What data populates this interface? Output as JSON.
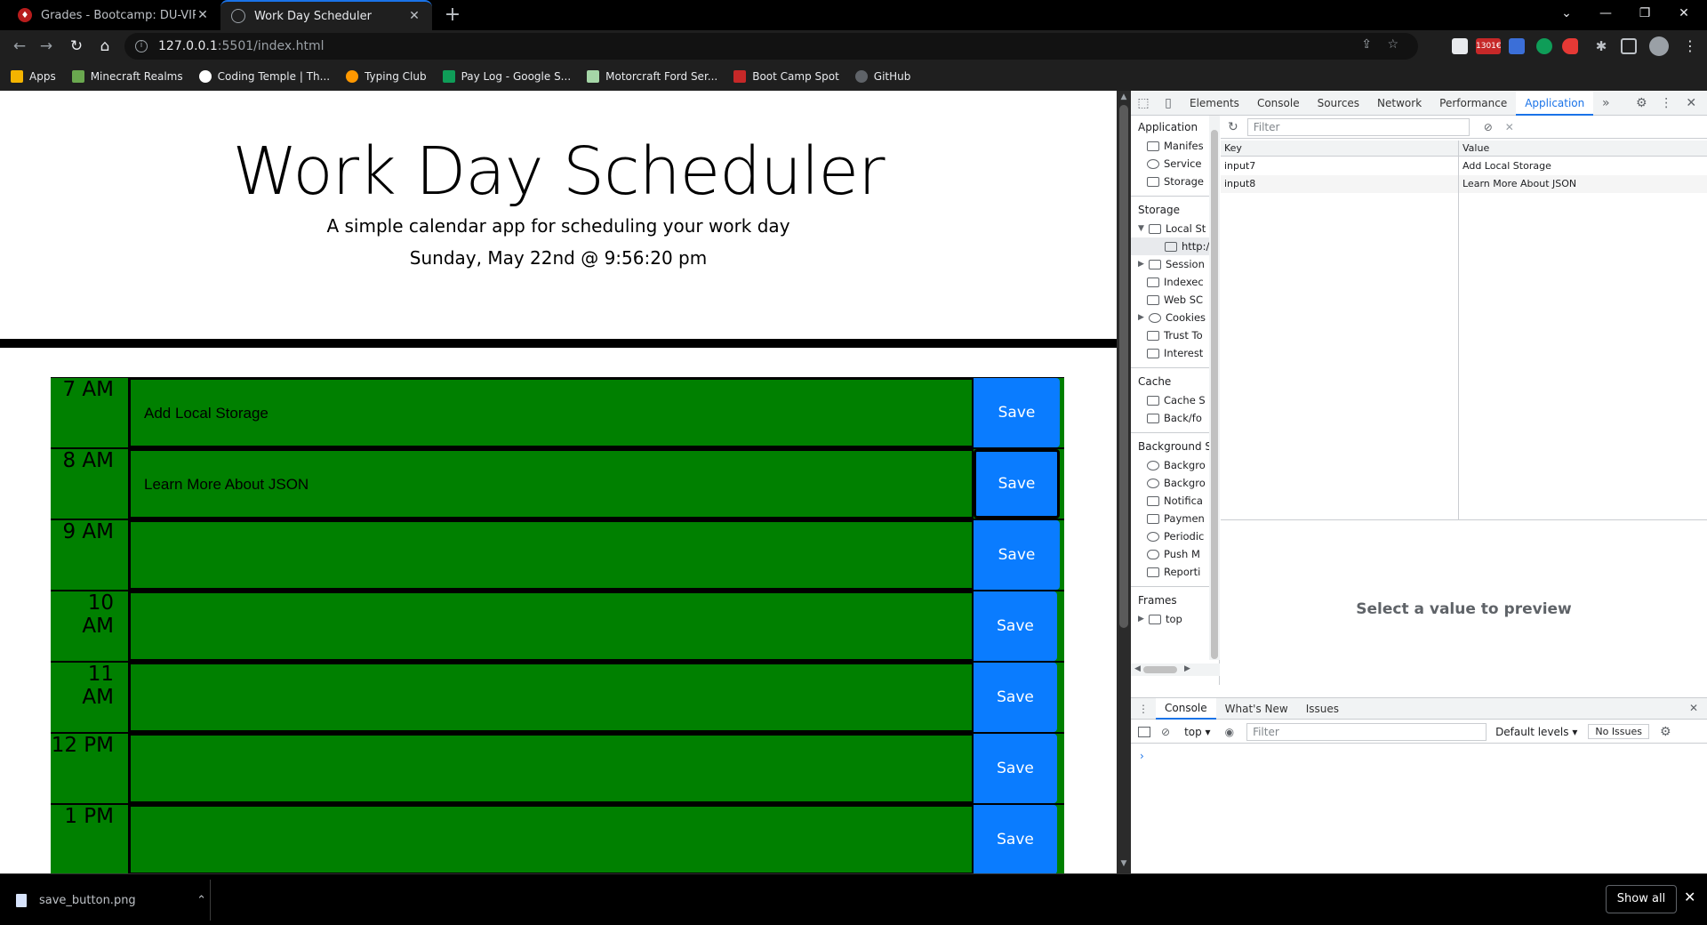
{
  "browser": {
    "tabs": [
      {
        "title": "Grades - Bootcamp: DU-VIRT-FSF",
        "favicon": "red-shield-icon"
      },
      {
        "title": "Work Day Scheduler",
        "favicon": "globe-icon",
        "active": true
      }
    ],
    "address": {
      "host": "127.0.0.1",
      "path": ":5501/index.html"
    },
    "extension_badge": "1301€",
    "bookmarks": [
      {
        "label": "Apps",
        "icon": "apps-grid-icon",
        "color": "#f4b400"
      },
      {
        "label": "Minecraft Realms",
        "icon": "grass-block-icon",
        "color": "#6aa84f"
      },
      {
        "label": "Coding Temple | Th...",
        "icon": "coding-temple-icon",
        "color": "#ffffff"
      },
      {
        "label": "Typing Club",
        "icon": "typing-club-icon",
        "color": "#ff9800"
      },
      {
        "label": "Pay Log - Google S...",
        "icon": "sheets-icon",
        "color": "#0f9d58"
      },
      {
        "label": "Motorcraft Ford Ser...",
        "icon": "motorcraft-icon",
        "color": "#a5d6a7"
      },
      {
        "label": "Boot Camp Spot",
        "icon": "red-shield-icon",
        "color": "#c62828"
      },
      {
        "label": "GitHub",
        "icon": "github-icon",
        "color": "#9aa0a6"
      }
    ]
  },
  "app": {
    "title": "Work Day Scheduler",
    "lead": "A simple calendar app for scheduling your work day",
    "current_day": "Sunday, May 22nd @ 9:56:20 pm",
    "row_color": "#008000",
    "save_color": "#0a7cff",
    "rows": [
      {
        "hour": "7 AM",
        "text": "Add Local Storage",
        "save": "Save"
      },
      {
        "hour": "8 AM",
        "text": "Learn More About JSON",
        "save": "Save"
      },
      {
        "hour": "9 AM",
        "text": "",
        "save": "Save"
      },
      {
        "hour": "10 AM",
        "text": "",
        "save": "Save"
      },
      {
        "hour": "11 AM",
        "text": "",
        "save": "Save"
      },
      {
        "hour": "12 PM",
        "text": "",
        "save": "Save"
      },
      {
        "hour": "1 PM",
        "text": "",
        "save": "Save"
      }
    ]
  },
  "devtools": {
    "tabs": [
      "Elements",
      "Console",
      "Sources",
      "Network",
      "Performance",
      "Application"
    ],
    "active_tab": "Application",
    "more": "»",
    "sidebar": {
      "application": {
        "header": "Application",
        "items": [
          "Manifes",
          "Service",
          "Storage"
        ]
      },
      "storage": {
        "header": "Storage",
        "items": [
          "Local St",
          "http:/",
          "Session",
          "Indexec",
          "Web SC",
          "Cookies",
          "Trust To",
          "Interest"
        ]
      },
      "cache": {
        "header": "Cache",
        "items": [
          "Cache S",
          "Back/fo"
        ]
      },
      "background": {
        "header": "Background Se",
        "items": [
          "Backgro",
          "Backgro",
          "Notifica",
          "Paymen",
          "Periodic",
          "Push M",
          "Reporti"
        ]
      },
      "frames": {
        "header": "Frames",
        "items": [
          "top"
        ]
      }
    },
    "filter_placeholder": "Filter",
    "table": {
      "headers": [
        "Key",
        "Value"
      ],
      "rows": [
        {
          "key": "input7",
          "value": "Add Local Storage"
        },
        {
          "key": "input8",
          "value": "Learn More About JSON"
        }
      ]
    },
    "preview_text": "Select a value to preview",
    "drawer": {
      "tabs": [
        "Console",
        "What's New",
        "Issues"
      ],
      "context": "top",
      "filter_placeholder": "Filter",
      "levels": "Default levels",
      "issues": "No Issues",
      "prompt": "›"
    }
  },
  "downloads": {
    "file": "save_button.png",
    "show_all": "Show all"
  }
}
